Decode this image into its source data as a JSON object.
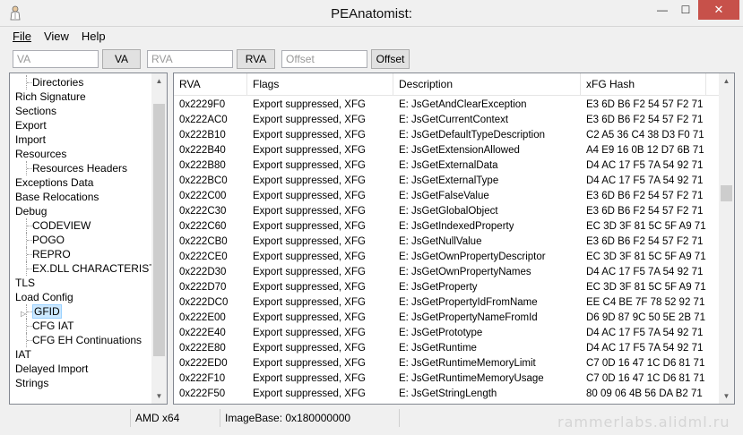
{
  "window": {
    "title": "PEAnatomist:",
    "minimize": "—",
    "maximize": "☐",
    "close": "✕"
  },
  "menu": [
    "File",
    "View",
    "Help"
  ],
  "toolbar": {
    "va_placeholder": "VA",
    "va_button": "VA",
    "rva_placeholder": "RVA",
    "rva_button": "RVA",
    "offset_placeholder": "Offset",
    "offset_button": "Offset"
  },
  "tree": [
    {
      "label": "Directories",
      "level": 1,
      "selected": false
    },
    {
      "label": "Rich Signature",
      "level": 0,
      "selected": false
    },
    {
      "label": "Sections",
      "level": 0,
      "selected": false
    },
    {
      "label": "Export",
      "level": 0,
      "selected": false
    },
    {
      "label": "Import",
      "level": 0,
      "selected": false
    },
    {
      "label": "Resources",
      "level": 0,
      "selected": false
    },
    {
      "label": "Resources Headers",
      "level": 1,
      "selected": false
    },
    {
      "label": "Exceptions Data",
      "level": 0,
      "selected": false
    },
    {
      "label": "Base Relocations",
      "level": 0,
      "selected": false
    },
    {
      "label": "Debug",
      "level": 0,
      "selected": false
    },
    {
      "label": "CODEVIEW",
      "level": 1,
      "selected": false
    },
    {
      "label": "POGO",
      "level": 1,
      "selected": false
    },
    {
      "label": "REPRO",
      "level": 1,
      "selected": false
    },
    {
      "label": "EX.DLL CHARACTERISTICS",
      "level": 1,
      "selected": false
    },
    {
      "label": "TLS",
      "level": 0,
      "selected": false
    },
    {
      "label": "Load Config",
      "level": 0,
      "selected": false
    },
    {
      "label": "GFID",
      "level": 1,
      "selected": true,
      "expander": "▷"
    },
    {
      "label": "CFG IAT",
      "level": 1,
      "selected": false
    },
    {
      "label": "CFG EH Continuations",
      "level": 1,
      "selected": false
    },
    {
      "label": "IAT",
      "level": 0,
      "selected": false
    },
    {
      "label": "Delayed Import",
      "level": 0,
      "selected": false
    },
    {
      "label": "Strings",
      "level": 0,
      "selected": false
    }
  ],
  "table": {
    "columns": [
      "RVA",
      "Flags",
      "Description",
      "xFG Hash"
    ],
    "rows": [
      [
        "0x2229F0",
        "Export suppressed, XFG",
        "E: JsGetAndClearException",
        "E3 6D B6 F2 54 57 F2 71"
      ],
      [
        "0x222AC0",
        "Export suppressed, XFG",
        "E: JsGetCurrentContext",
        "E3 6D B6 F2 54 57 F2 71"
      ],
      [
        "0x222B10",
        "Export suppressed, XFG",
        "E: JsGetDefaultTypeDescription",
        "C2 A5 36 C4 38 D3 F0 71"
      ],
      [
        "0x222B40",
        "Export suppressed, XFG",
        "E: JsGetExtensionAllowed",
        "A4 E9 16 0B 12 D7 6B 71"
      ],
      [
        "0x222B80",
        "Export suppressed, XFG",
        "E: JsGetExternalData",
        "D4 AC 17 F5 7A 54 92 71"
      ],
      [
        "0x222BC0",
        "Export suppressed, XFG",
        "E: JsGetExternalType",
        "D4 AC 17 F5 7A 54 92 71"
      ],
      [
        "0x222C00",
        "Export suppressed, XFG",
        "E: JsGetFalseValue",
        "E3 6D B6 F2 54 57 F2 71"
      ],
      [
        "0x222C30",
        "Export suppressed, XFG",
        "E: JsGetGlobalObject",
        "E3 6D B6 F2 54 57 F2 71"
      ],
      [
        "0x222C60",
        "Export suppressed, XFG",
        "E: JsGetIndexedProperty",
        "EC 3D 3F 81 5C 5F A9 71"
      ],
      [
        "0x222CB0",
        "Export suppressed, XFG",
        "E: JsGetNullValue",
        "E3 6D B6 F2 54 57 F2 71"
      ],
      [
        "0x222CE0",
        "Export suppressed, XFG",
        "E: JsGetOwnPropertyDescriptor",
        "EC 3D 3F 81 5C 5F A9 71"
      ],
      [
        "0x222D30",
        "Export suppressed, XFG",
        "E: JsGetOwnPropertyNames",
        "D4 AC 17 F5 7A 54 92 71"
      ],
      [
        "0x222D70",
        "Export suppressed, XFG",
        "E: JsGetProperty",
        "EC 3D 3F 81 5C 5F A9 71"
      ],
      [
        "0x222DC0",
        "Export suppressed, XFG",
        "E: JsGetPropertyIdFromName",
        "EE C4 BE 7F 78 52 92 71"
      ],
      [
        "0x222E00",
        "Export suppressed, XFG",
        "E: JsGetPropertyNameFromId",
        "D6 9D 87 9C 50 5E 2B 71"
      ],
      [
        "0x222E40",
        "Export suppressed, XFG",
        "E: JsGetPrototype",
        "D4 AC 17 F5 7A 54 92 71"
      ],
      [
        "0x222E80",
        "Export suppressed, XFG",
        "E: JsGetRuntime",
        "D4 AC 17 F5 7A 54 92 71"
      ],
      [
        "0x222ED0",
        "Export suppressed, XFG",
        "E: JsGetRuntimeMemoryLimit",
        "C7 0D 16 47 1C D6 81 71"
      ],
      [
        "0x222F10",
        "Export suppressed, XFG",
        "E: JsGetRuntimeMemoryUsage",
        "C7 0D 16 47 1C D6 81 71"
      ],
      [
        "0x222F50",
        "Export suppressed, XFG",
        "E: JsGetStringLength",
        "80 09 06 4B 56 DA B2 71"
      ]
    ]
  },
  "status": {
    "arch": "AMD x64",
    "image_base": "ImageBase: 0x180000000"
  },
  "watermark": "rammerlabs.alidml.ru",
  "tree_scroll_level": 0.32,
  "table_scroll_level": 0.34
}
